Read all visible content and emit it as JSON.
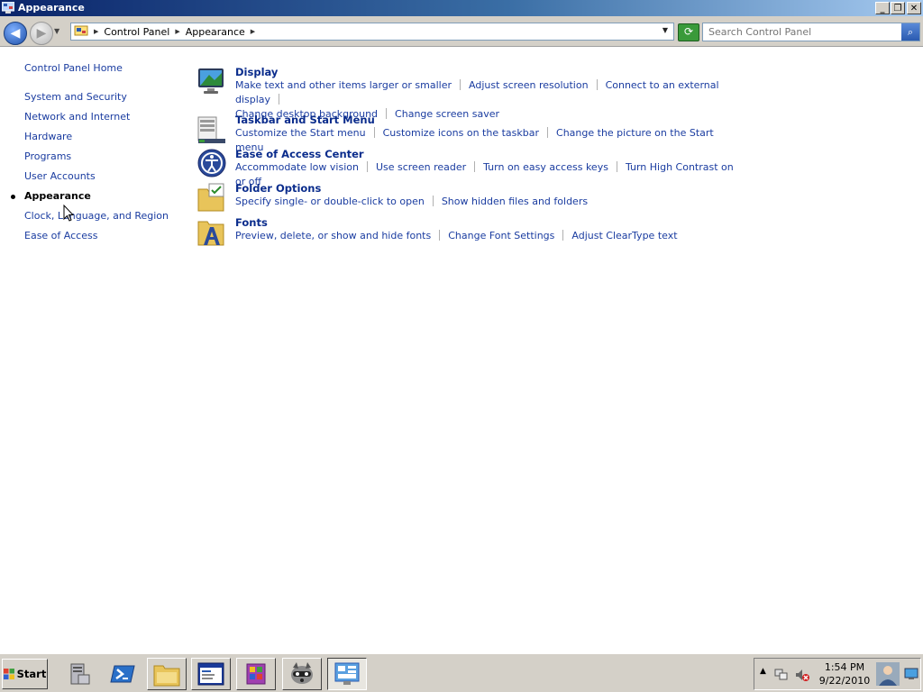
{
  "window": {
    "title": "Appearance"
  },
  "address": {
    "crumbs": [
      "Control Panel",
      "Appearance"
    ]
  },
  "search": {
    "placeholder": "Search Control Panel"
  },
  "leftnav": {
    "home": "Control Panel Home",
    "items": [
      "System and Security",
      "Network and Internet",
      "Hardware",
      "Programs",
      "User Accounts",
      "Appearance",
      "Clock, Language, and Region",
      "Ease of Access"
    ],
    "current": "Appearance"
  },
  "sections": [
    {
      "title": "Display",
      "icon": "display-icon",
      "links": [
        "Make text and other items larger or smaller",
        "Adjust screen resolution",
        "Connect to an external display",
        "Change desktop background",
        "Change screen saver"
      ]
    },
    {
      "title": "Taskbar and Start Menu",
      "icon": "taskbar-icon",
      "links": [
        "Customize the Start menu",
        "Customize icons on the taskbar",
        "Change the picture on the Start menu"
      ]
    },
    {
      "title": "Ease of Access Center",
      "icon": "ease-of-access-icon",
      "links": [
        "Accommodate low vision",
        "Use screen reader",
        "Turn on easy access keys",
        "Turn High Contrast on or off"
      ]
    },
    {
      "title": "Folder Options",
      "icon": "folder-options-icon",
      "links": [
        "Specify single- or double-click to open",
        "Show hidden files and folders"
      ]
    },
    {
      "title": "Fonts",
      "icon": "fonts-icon",
      "links": [
        "Preview, delete, or show and hide fonts",
        "Change Font Settings",
        "Adjust ClearType text"
      ]
    }
  ],
  "taskbar": {
    "start_label": "Start",
    "clock_time": "1:54 PM",
    "clock_date": "9/22/2010"
  },
  "colors": {
    "link": "#1a3ca0",
    "title_link": "#0a2c8c",
    "titlebar_start": "#0a246a"
  }
}
